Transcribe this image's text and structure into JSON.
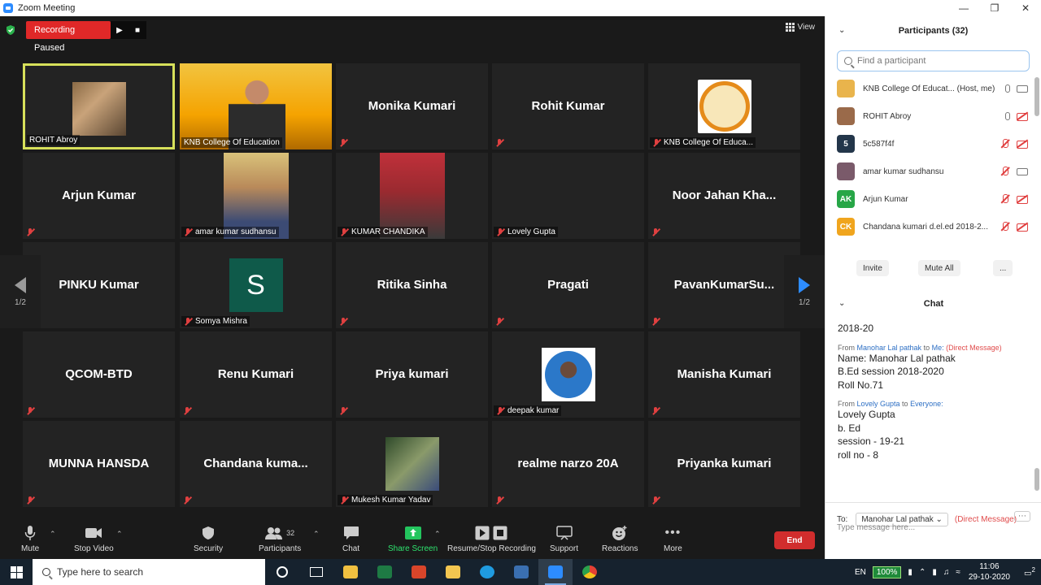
{
  "window": {
    "title": "Zoom Meeting"
  },
  "recording": {
    "status": "Recording Paused"
  },
  "view_label": "View",
  "tiles": [
    {
      "name": "ROHIT Abroy",
      "label": "ROHIT Abroy",
      "kind": "photo-rohit",
      "active": true,
      "muted": false
    },
    {
      "name": "KNB College Of Education",
      "label": "KNB College Of Education",
      "kind": "photo-knb",
      "muted": false
    },
    {
      "name": "Monika Kumari",
      "kind": "name",
      "muted": true
    },
    {
      "name": "Rohit Kumar",
      "kind": "name",
      "muted": true
    },
    {
      "name": "KNB College Of Educa...",
      "label": "KNB College Of Educa...",
      "kind": "logo-knb",
      "muted": true
    },
    {
      "name": "Arjun Kumar",
      "kind": "name",
      "muted": true
    },
    {
      "name": "amar kumar sudhansu",
      "label": "amar kumar sudhansu",
      "kind": "photo-amar",
      "muted": true
    },
    {
      "name": "KUMAR CHANDIKA",
      "label": "KUMAR CHANDIKA",
      "kind": "photo-chandika",
      "muted": true
    },
    {
      "name": "Lovely Gupta",
      "label": "Lovely Gupta",
      "kind": "blank",
      "muted": true
    },
    {
      "name": "Noor Jahan Kha...",
      "kind": "name",
      "muted": true
    },
    {
      "name": "PINKU Kumar",
      "kind": "name",
      "muted": true
    },
    {
      "name": "Somya Mishra",
      "label": "Somya Mishra",
      "kind": "avatar-s",
      "avatar_letter": "S",
      "muted": true
    },
    {
      "name": "Ritika Sinha",
      "kind": "name",
      "muted": true
    },
    {
      "name": "Pragati",
      "kind": "name",
      "muted": true
    },
    {
      "name": "PavanKumarSu...",
      "kind": "name",
      "muted": true
    },
    {
      "name": "QCOM-BTD",
      "kind": "name",
      "muted": true
    },
    {
      "name": "Renu Kumari",
      "kind": "name",
      "muted": true
    },
    {
      "name": "Priya kumari",
      "kind": "name",
      "muted": true
    },
    {
      "name": "deepak kumar",
      "label": "deepak kumar",
      "kind": "photo-deepak",
      "muted": true
    },
    {
      "name": "Manisha Kumari",
      "kind": "name",
      "muted": true
    },
    {
      "name": "MUNNA HANSDA",
      "kind": "name",
      "muted": true
    },
    {
      "name": "Chandana  kuma...",
      "kind": "name",
      "muted": true
    },
    {
      "name": "Mukesh Kumar Yadav",
      "label": "Mukesh Kumar Yadav",
      "kind": "photo-mukesh",
      "muted": true
    },
    {
      "name": "realme narzo 20A",
      "kind": "name",
      "muted": true
    },
    {
      "name": "Priyanka kumari",
      "kind": "name",
      "muted": true
    }
  ],
  "pager": {
    "left": "1/2",
    "right": "1/2"
  },
  "toolbar": {
    "mute": "Mute",
    "stop_video": "Stop Video",
    "security": "Security",
    "participants": "Participants",
    "participants_count": "32",
    "chat": "Chat",
    "share_screen": "Share Screen",
    "resume_stop_recording": "Resume/Stop Recording",
    "support": "Support",
    "reactions": "Reactions",
    "more": "More",
    "end": "End"
  },
  "participants_panel": {
    "title": "Participants (32)",
    "search_placeholder": "Find a participant",
    "list": [
      {
        "name": "KNB College Of Educat... (Host, me)",
        "avatar": "",
        "avatar_color": "#e9b44c",
        "mic": "on",
        "cam": "on"
      },
      {
        "name": "ROHIT Abroy",
        "avatar": "",
        "avatar_color": "#9a6a4a",
        "mic": "on",
        "cam": "off"
      },
      {
        "name": "5c587f4f",
        "avatar": "5",
        "avatar_color": "#23364a",
        "mic": "off",
        "cam": "off"
      },
      {
        "name": "amar kumar sudhansu",
        "avatar": "",
        "avatar_color": "#7a5a6a",
        "mic": "off",
        "cam": "on"
      },
      {
        "name": "Arjun Kumar",
        "avatar": "AK",
        "avatar_color": "#27a647",
        "mic": "off",
        "cam": "off"
      },
      {
        "name": "Chandana kumari d.el.ed 2018-2...",
        "avatar": "CK",
        "avatar_color": "#f0a51e",
        "mic": "off",
        "cam": "off"
      }
    ],
    "invite": "Invite",
    "mute_all": "Mute All",
    "more": "..."
  },
  "chat_panel": {
    "title": "Chat",
    "partial_line": "2018-20",
    "messages": [
      {
        "from": "Manohar Lal pathak",
        "to": "Me:",
        "tag": "(Direct Message)",
        "lines": [
          "Name: Manohar Lal pathak",
          "B.Ed session 2018-2020",
          "Roll No.71"
        ]
      },
      {
        "from": "Lovely Gupta",
        "to": "Everyone:",
        "tag": "",
        "lines": [
          "Lovely Gupta",
          "b. Ed",
          "session - 19-21",
          "roll no - 8"
        ]
      }
    ],
    "to_label": "To:",
    "to_recipient": "Manohar Lal pathak",
    "to_tag": "(Direct Message)",
    "input_placeholder": "Type message here..."
  },
  "taskbar": {
    "search_placeholder": "Type here to search",
    "lang": "EN",
    "battery": "100%",
    "time": "11:06",
    "date": "29-10-2020",
    "notif_count": "2"
  }
}
